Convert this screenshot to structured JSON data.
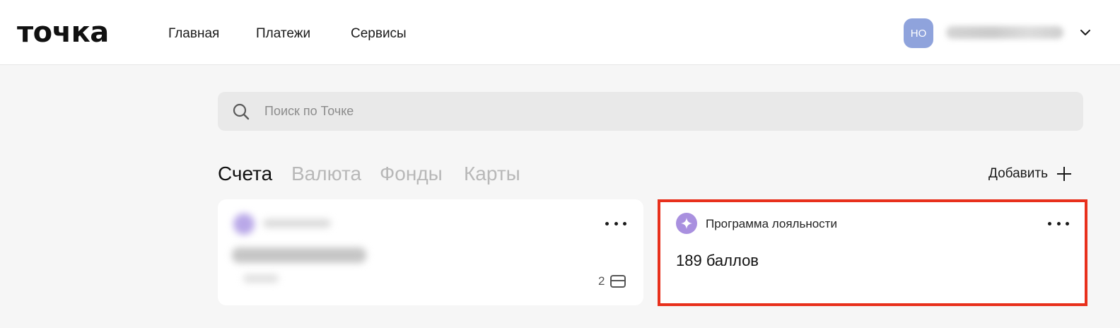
{
  "header": {
    "logo": "точка",
    "nav": [
      "Главная",
      "Платежи",
      "Сервисы"
    ],
    "avatar_initials": "НО"
  },
  "search": {
    "placeholder": "Поиск по Точке"
  },
  "tabs": [
    {
      "label": "Счета",
      "active": true
    },
    {
      "label": "Валюта",
      "active": false
    },
    {
      "label": "Фонды",
      "active": false
    },
    {
      "label": "Карты",
      "active": false
    }
  ],
  "add_button": {
    "label": "Добавить"
  },
  "account_card": {
    "cards_count": "2"
  },
  "loyalty_card": {
    "title": "Программа лояльности",
    "points": "189 баллов",
    "highlight_color": "#e8301c"
  },
  "colors": {
    "avatar": "#8fa3dc",
    "loyalty_icon": "#a990df",
    "background": "#f6f6f6"
  }
}
